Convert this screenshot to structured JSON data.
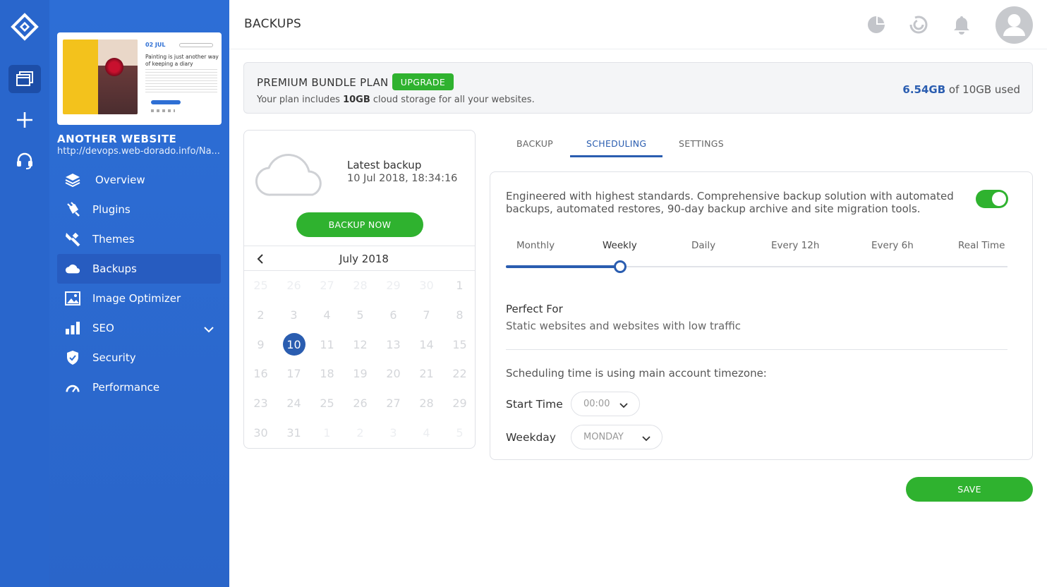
{
  "colors": {
    "rail": "#2966cc",
    "sidebar": "#2e6fd4",
    "accent": "#2a5db0",
    "success": "#2fb22f"
  },
  "rail": {
    "items": [
      {
        "icon": "diamond-logo-icon"
      },
      {
        "icon": "websites-icon",
        "active": true
      },
      {
        "icon": "plus-icon"
      },
      {
        "icon": "support-headset-icon"
      }
    ]
  },
  "sidebar": {
    "preview": {
      "date": "02 JUL",
      "title": "Painting is just another way of keeping a diary"
    },
    "site_name": "ANOTHER WEBSITE",
    "site_url": "http://devops.web-dorado.info/Na...",
    "items": [
      {
        "label": "Overview",
        "icon": "layers-icon"
      },
      {
        "label": "Plugins",
        "icon": "plug-icon"
      },
      {
        "label": "Themes",
        "icon": "brush-icon"
      },
      {
        "label": "Backups",
        "icon": "cloud-icon",
        "active": true
      },
      {
        "label": "Image Optimizer",
        "icon": "image-icon"
      },
      {
        "label": "SEO",
        "icon": "bar-chart-icon",
        "expandable": true
      },
      {
        "label": "Security",
        "icon": "shield-icon"
      },
      {
        "label": "Performance",
        "icon": "gauge-icon"
      }
    ]
  },
  "header": {
    "title": "BACKUPS",
    "icons": [
      "pie-chart-icon",
      "spinner-icon",
      "bell-icon",
      "user-avatar-icon"
    ]
  },
  "plan": {
    "name": "PREMIUM BUNDLE PLAN",
    "upgrade_label": "UPGRADE",
    "desc_prefix": "Your plan includes ",
    "desc_bold": "10GB",
    "desc_suffix": " cloud storage for all your websites.",
    "used_amount": "6.54GB",
    "used_suffix": " of 10GB used"
  },
  "backup": {
    "latest_label": "Latest backup",
    "latest_date": "10 Jul 2018, 18:34:16",
    "button_label": "BACKUP NOW"
  },
  "calendar": {
    "month": "July 2018",
    "selected": 10,
    "weeks": [
      [
        "25",
        "26",
        "27",
        "28",
        "29",
        "30",
        "1"
      ],
      [
        "2",
        "3",
        "4",
        "5",
        "6",
        "7",
        "8"
      ],
      [
        "9",
        "10",
        "11",
        "12",
        "13",
        "14",
        "15"
      ],
      [
        "16",
        "17",
        "18",
        "19",
        "20",
        "21",
        "22"
      ],
      [
        "23",
        "24",
        "25",
        "26",
        "27",
        "28",
        "29"
      ],
      [
        "30",
        "31",
        "1",
        "2",
        "3",
        "4",
        "5"
      ]
    ]
  },
  "tabs": [
    {
      "label": "BACKUP"
    },
    {
      "label": "SCHEDULING",
      "active": true
    },
    {
      "label": "SETTINGS"
    }
  ],
  "scheduling": {
    "description": "Engineered with highest standards. Comprehensive backup solution with automated backups, automated restores, 90-day backup archive and site migration tools.",
    "enabled": true,
    "frequencies": [
      "Monthly",
      "Weekly",
      "Daily",
      "Every 12h",
      "Every 6h",
      "Real Time"
    ],
    "selected_frequency": "Weekly",
    "perfect_for_title": "Perfect For",
    "perfect_for_desc": "Static websites and websites with low traffic",
    "timezone_note": "Scheduling time is using main account timezone:",
    "start_time_label": "Start Time",
    "start_time_value": "00:00",
    "weekday_label": "Weekday",
    "weekday_value": "MONDAY"
  },
  "save_label": "SAVE"
}
